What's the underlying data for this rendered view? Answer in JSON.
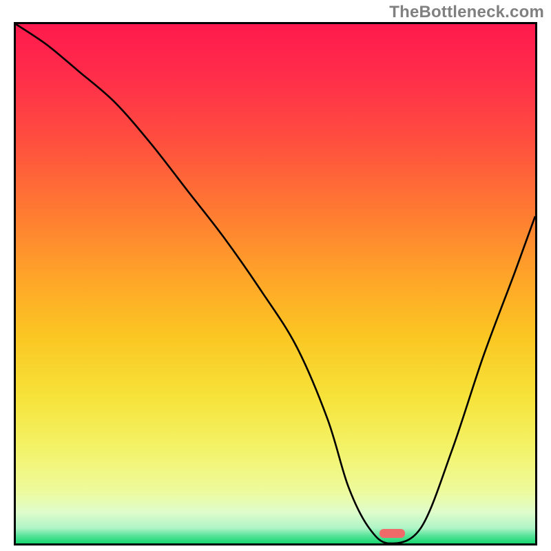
{
  "watermark": "TheBottleneck.com",
  "chart_data": {
    "type": "line",
    "title": "",
    "xlabel": "",
    "ylabel": "",
    "xlim": [
      0,
      100
    ],
    "ylim": [
      0,
      100
    ],
    "x": [
      0,
      6,
      12,
      19,
      26,
      33,
      40,
      47,
      54,
      60,
      64,
      68,
      72,
      78,
      84,
      90,
      96,
      100
    ],
    "values": [
      100,
      96,
      91,
      85,
      77,
      68,
      59,
      49,
      38,
      24,
      11,
      3,
      0,
      3,
      18,
      36,
      52,
      63
    ],
    "background_gradient": {
      "stops": [
        {
          "pos": 0.0,
          "color": "#ff1a4d"
        },
        {
          "pos": 0.1,
          "color": "#ff2d4a"
        },
        {
          "pos": 0.22,
          "color": "#ff4d3f"
        },
        {
          "pos": 0.35,
          "color": "#ff7733"
        },
        {
          "pos": 0.48,
          "color": "#ffa229"
        },
        {
          "pos": 0.6,
          "color": "#fbc622"
        },
        {
          "pos": 0.72,
          "color": "#f6e33a"
        },
        {
          "pos": 0.82,
          "color": "#f3f36a"
        },
        {
          "pos": 0.9,
          "color": "#eefb9d"
        },
        {
          "pos": 0.94,
          "color": "#dffccb"
        },
        {
          "pos": 0.97,
          "color": "#b0f5c7"
        },
        {
          "pos": 0.985,
          "color": "#58e49a"
        },
        {
          "pos": 1.0,
          "color": "#17d66f"
        }
      ]
    },
    "marker": {
      "x": 70,
      "y": 1,
      "w": 5,
      "h": 1.8
    }
  }
}
